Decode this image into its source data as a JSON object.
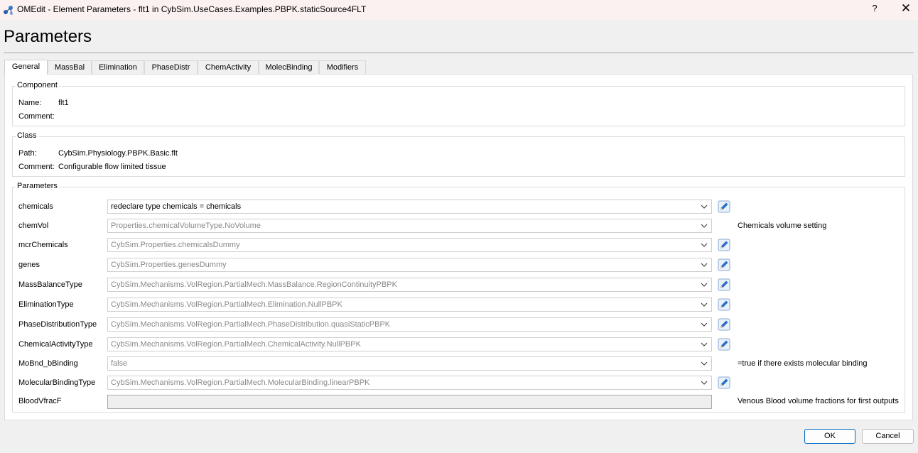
{
  "window": {
    "title": "OMEdit - Element Parameters - flt1 in CybSim.UseCases.Examples.PBPK.staticSource4FLT",
    "help_glyph": "?",
    "close_glyph": "✕",
    "app_icon": "omedit-logo-icon"
  },
  "heading": "Parameters",
  "tabs": [
    "General",
    "MassBal",
    "Elimination",
    "PhaseDistr",
    "ChemActivity",
    "MolecBinding",
    "Modifiers"
  ],
  "active_tab": "General",
  "component": {
    "title": "Component",
    "name_label": "Name:",
    "name_value": "flt1",
    "comment_label": "Comment:",
    "comment_value": ""
  },
  "class": {
    "title": "Class",
    "path_label": "Path:",
    "path_value": "CybSim.Physiology.PBPK.Basic.flt",
    "comment_label": "Comment:",
    "comment_value": "Configurable flow limited tissue"
  },
  "parameters": {
    "title": "Parameters",
    "rows": [
      {
        "name": "chemicals",
        "value": "redeclare type chemicals = chemicals",
        "enabled": true,
        "edit_button": true,
        "comment": ""
      },
      {
        "name": "chemVol",
        "value": "Properties.chemicalVolumeType.NoVolume",
        "enabled": false,
        "edit_button": false,
        "comment": "Chemicals volume setting"
      },
      {
        "name": "mcrChemicals",
        "value": "CybSim.Properties.chemicalsDummy",
        "enabled": false,
        "edit_button": true,
        "comment": ""
      },
      {
        "name": "genes",
        "value": "CybSim.Properties.genesDummy",
        "enabled": false,
        "edit_button": true,
        "comment": ""
      },
      {
        "name": "MassBalanceType",
        "value": "CybSim.Mechanisms.VolRegion.PartialMech.MassBalance.RegionContinuityPBPK",
        "enabled": false,
        "edit_button": true,
        "comment": ""
      },
      {
        "name": "EliminationType",
        "value": "CybSim.Mechanisms.VolRegion.PartialMech.Elimination.NullPBPK",
        "enabled": false,
        "edit_button": true,
        "comment": ""
      },
      {
        "name": "PhaseDistributionType",
        "value": "CybSim.Mechanisms.VolRegion.PartialMech.PhaseDistribution.quasiStaticPBPK",
        "enabled": false,
        "edit_button": true,
        "comment": ""
      },
      {
        "name": "ChemicalActivityType",
        "value": "CybSim.Mechanisms.VolRegion.PartialMech.ChemicalActivity.NullPBPK",
        "enabled": false,
        "edit_button": true,
        "comment": ""
      },
      {
        "name": "MoBnd_bBinding",
        "value": "false",
        "enabled": false,
        "edit_button": false,
        "comment": "=true if there exists molecular binding"
      },
      {
        "name": "MolecularBindingType",
        "value": "CybSim.Mechanisms.VolRegion.PartialMech.MolecularBinding.linearPBPK",
        "enabled": false,
        "edit_button": true,
        "comment": ""
      }
    ],
    "blood": {
      "name": "BloodVfracF",
      "value": "",
      "comment": "Venous Blood volume fractions for first outputs"
    }
  },
  "buttons": {
    "ok": "OK",
    "cancel": "Cancel"
  },
  "icons": {
    "dropdown": "chevron-down-icon",
    "edit": "pencil-edit-icon"
  },
  "colors": {
    "default_button_border": "#0067c0",
    "titlebar": "#fbf1f1",
    "edit_icon": "#2a6fc9"
  }
}
